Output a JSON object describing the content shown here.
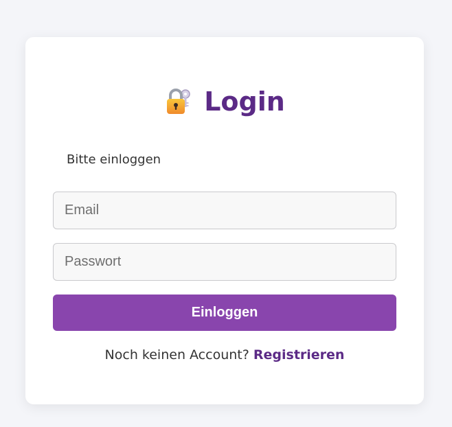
{
  "colors": {
    "page_background": "#f4f5f9",
    "title": "#5b2a86",
    "button_background": "#8945ad",
    "link": "#5b2a86"
  },
  "login": {
    "icon": "locked-with-key-icon",
    "title": "Login",
    "subtitle": "Bitte einloggen",
    "email_placeholder": "Email",
    "password_placeholder": "Passwort",
    "submit_label": "Einloggen",
    "footer_text": "Noch keinen Account?",
    "register_link": "Registrieren"
  }
}
